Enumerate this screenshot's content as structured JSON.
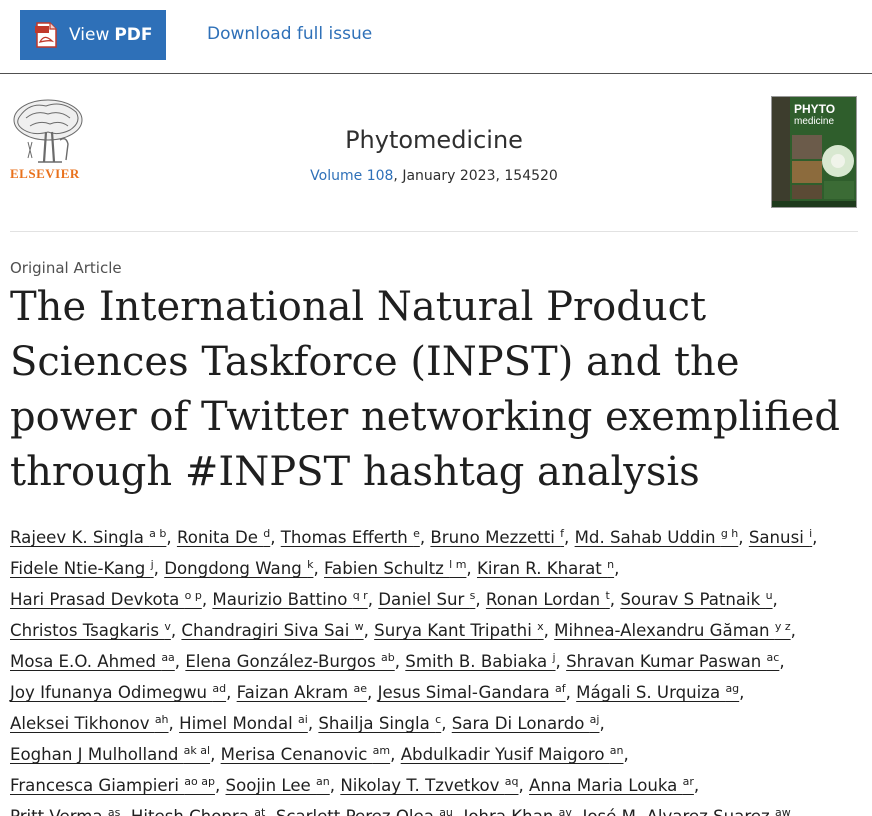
{
  "toolbar": {
    "view_label": "View",
    "pdf_label": "PDF",
    "download_label": "Download full issue"
  },
  "publisher": {
    "name": "ELSEVIER"
  },
  "journal": {
    "title": "Phytomedicine",
    "volume_link": "Volume 108",
    "issue_info": ", January 2023, 154520",
    "cover_title_line1": "PHYTO",
    "cover_title_line2": "medicine"
  },
  "article": {
    "type": "Original Article",
    "title": "The International Natural Product Sciences Taskforce (INPST) and the power of Twitter networking exemplified through #INPST hashtag analysis"
  },
  "authors": [
    [
      {
        "name": "Rajeev K. Singla",
        "sup": "a b"
      },
      {
        "name": "Ronita De",
        "sup": "d"
      },
      {
        "name": "Thomas Efferth",
        "sup": "e"
      },
      {
        "name": "Bruno Mezzetti",
        "sup": "f"
      },
      {
        "name": "Md. Sahab Uddin",
        "sup": "g h"
      },
      {
        "name": "Sanusi",
        "sup": "i"
      }
    ],
    [
      {
        "name": "Fidele Ntie-Kang",
        "sup": "j"
      },
      {
        "name": "Dongdong Wang",
        "sup": "k"
      },
      {
        "name": "Fabien Schultz",
        "sup": "l m"
      },
      {
        "name": "Kiran R. Kharat",
        "sup": "n"
      }
    ],
    [
      {
        "name": "Hari Prasad Devkota",
        "sup": "o p"
      },
      {
        "name": "Maurizio Battino",
        "sup": "q r"
      },
      {
        "name": "Daniel Sur",
        "sup": "s"
      },
      {
        "name": "Ronan Lordan",
        "sup": "t"
      },
      {
        "name": "Sourav S Patnaik",
        "sup": "u"
      }
    ],
    [
      {
        "name": "Christos Tsagkaris",
        "sup": "v"
      },
      {
        "name": "Chandragiri Siva Sai",
        "sup": "w"
      },
      {
        "name": "Surya Kant Tripathi",
        "sup": "x"
      },
      {
        "name": "Mihnea-Alexandru Găman",
        "sup": "y z"
      }
    ],
    [
      {
        "name": "Mosa E.O. Ahmed",
        "sup": "aa"
      },
      {
        "name": "Elena González-Burgos",
        "sup": "ab"
      },
      {
        "name": "Smith B. Babiaka",
        "sup": "j"
      },
      {
        "name": "Shravan Kumar Paswan",
        "sup": "ac"
      }
    ],
    [
      {
        "name": "Joy Ifunanya Odimegwu",
        "sup": "ad"
      },
      {
        "name": "Faizan Akram",
        "sup": "ae"
      },
      {
        "name": "Jesus Simal-Gandara",
        "sup": "af"
      },
      {
        "name": "Mágali S. Urquiza",
        "sup": "ag"
      }
    ],
    [
      {
        "name": "Aleksei Tikhonov",
        "sup": "ah"
      },
      {
        "name": "Himel Mondal",
        "sup": "ai"
      },
      {
        "name": "Shailja Singla",
        "sup": "c"
      },
      {
        "name": "Sara Di Lonardo",
        "sup": "aj"
      }
    ],
    [
      {
        "name": "Eoghan J Mulholland",
        "sup": "ak al"
      },
      {
        "name": "Merisa Cenanovic",
        "sup": "am"
      },
      {
        "name": "Abdulkadir Yusif Maigoro",
        "sup": "an"
      }
    ],
    [
      {
        "name": "Francesca Giampieri",
        "sup": "ao ap"
      },
      {
        "name": "Soojin Lee",
        "sup": "an"
      },
      {
        "name": "Nikolay T. Tzvetkov",
        "sup": "aq"
      },
      {
        "name": "Anna Maria Louka",
        "sup": "ar"
      }
    ],
    [
      {
        "name": "Pritt Verma",
        "sup": "as"
      },
      {
        "name": "Hitesh Chopra",
        "sup": "at"
      },
      {
        "name": "Scarlett Perez Olea",
        "sup": "au"
      },
      {
        "name": "Johra Khan",
        "sup": "av"
      },
      {
        "name": "José M. Alvarez Suarez",
        "sup": "aw"
      }
    ]
  ],
  "colors": {
    "accent": "#2e70b8",
    "elsevier_orange": "#e9711c",
    "text": "#1f1f1f"
  }
}
